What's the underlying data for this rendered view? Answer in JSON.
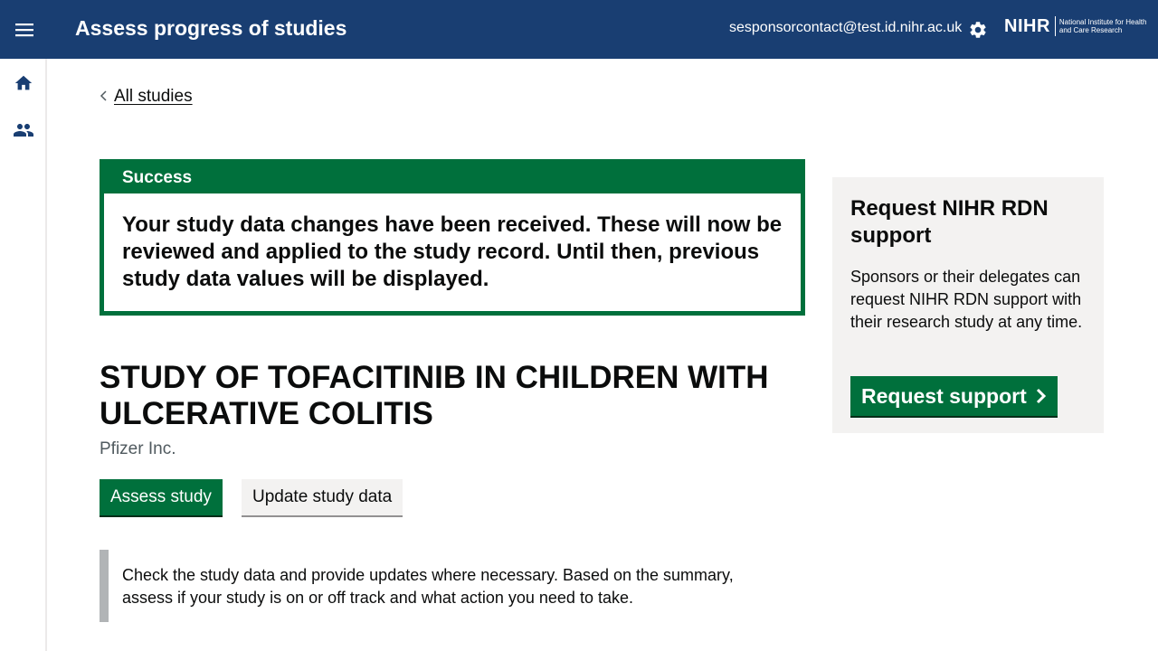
{
  "header": {
    "title": "Assess progress of studies",
    "user_email": "sesponsorcontact@test.id.nihr.ac.uk",
    "logo_mark": "NIHR",
    "logo_text": "National Institute for Health and Care Research",
    "icons": {
      "menu": "hamburger-menu-icon",
      "settings": "gear-icon"
    }
  },
  "sidebar": {
    "items": [
      {
        "icon": "home-icon"
      },
      {
        "icon": "users-icon"
      }
    ]
  },
  "breadcrumb": {
    "back_label": "All studies"
  },
  "banner": {
    "title": "Success",
    "message": "Your study data changes have been received. These will now be reviewed and applied to the study record. Until then, previous study data values will be displayed."
  },
  "study": {
    "title": "STUDY OF TOFACITINIB IN CHILDREN WITH ULCERATIVE COLITIS",
    "sponsor": "Pfizer Inc."
  },
  "actions": {
    "assess_label": "Assess study",
    "update_label": "Update study data"
  },
  "inset": {
    "text": "Check the study data and provide updates where necessary. Based on the summary, assess if your study is on or off track and what action you need to take."
  },
  "support_panel": {
    "title": "Request NIHR RDN support",
    "body": "Sponsors or their delegates can request NIHR RDN support with their research study at any time.",
    "button_label": "Request support"
  },
  "colors": {
    "header_bg": "#193e72",
    "success_green": "#00703c",
    "panel_bg": "#f3f2f1",
    "inset_border": "#b1b4b6"
  }
}
